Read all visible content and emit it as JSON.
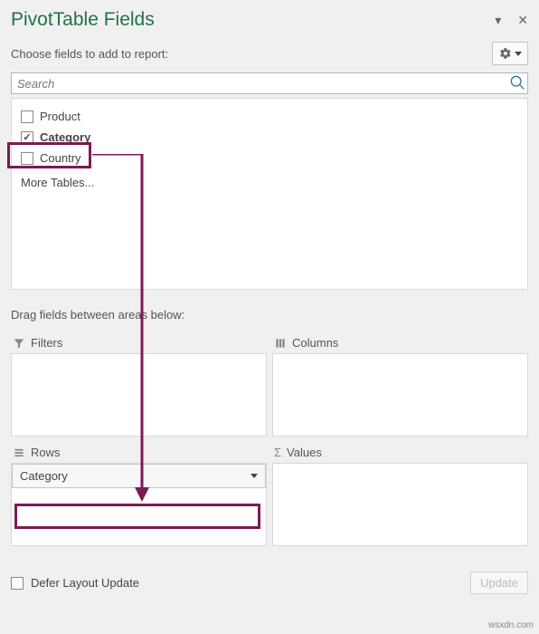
{
  "header": {
    "title": "PivotTable Fields",
    "subtitle": "Choose fields to add to report:"
  },
  "search": {
    "placeholder": "Search"
  },
  "fields": {
    "product": "Product",
    "category": "Category",
    "country": "Country",
    "more": "More Tables..."
  },
  "drag_label": "Drag fields between areas below:",
  "areas": {
    "filters": "Filters",
    "columns": "Columns",
    "rows": "Rows",
    "values": "Values",
    "rows_item": "Category"
  },
  "footer": {
    "defer": "Defer Layout Update",
    "update": "Update"
  },
  "watermark": "wsxdn.com",
  "highlight_color": "#7b1a56"
}
